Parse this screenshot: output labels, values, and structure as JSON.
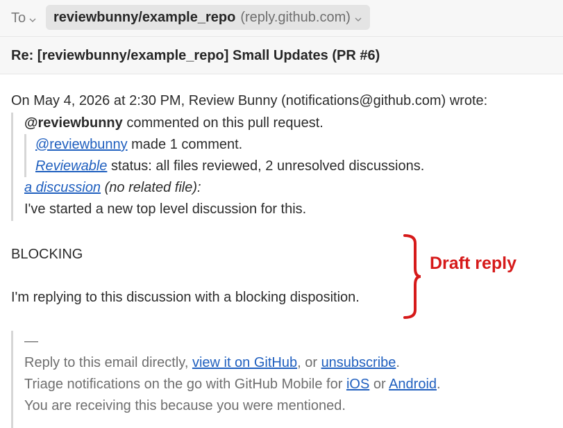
{
  "header": {
    "to_label": "To",
    "recipient_name": "reviewbunny/example_repo",
    "recipient_address": "(reply.github.com)",
    "subject": "Re: [reviewbunny/example_repo] Small Updates (PR #6)"
  },
  "message": {
    "attribution": "On May 4, 2026 at 2:30 PM, Review Bunny (notifications@github.com) wrote:",
    "quoted": {
      "author": "@reviewbunny",
      "commented_text": " commented on this pull request.",
      "mention_link": "@reviewbunny",
      "mention_text": " made 1 comment.",
      "reviewable_link": "Reviewable",
      "status_text": " status: all files reviewed, 2 unresolved discussions.",
      "discussion_link": "a discussion",
      "discussion_note": " (no related file):",
      "discussion_body": "I've started a new top level discussion for this."
    },
    "reply_disposition": "BLOCKING",
    "reply_body": "I'm replying to this discussion with a blocking disposition."
  },
  "annotation": {
    "label": "Draft reply",
    "color": "#d61a1a"
  },
  "footer": {
    "separator": "—",
    "line1_prefix": "Reply to this email directly, ",
    "view_link": "view it on GitHub",
    "line1_mid": ", or ",
    "unsubscribe_link": "unsubscribe",
    "line1_suffix": ".",
    "line2_prefix": "Triage notifications on the go with GitHub Mobile for ",
    "ios_link": "iOS",
    "line2_mid": " or ",
    "android_link": "Android",
    "line2_suffix": ".",
    "line3": "You are receiving this because you were mentioned."
  },
  "colors": {
    "link": "#1f5fbf",
    "header_bg": "#f7f7f7",
    "chip_bg": "#e4e4e4",
    "quote_bar": "#d6d6d6"
  },
  "icons": {
    "to_dropdown": "chevron-down-icon",
    "recipient_dropdown": "chevron-down-icon"
  }
}
